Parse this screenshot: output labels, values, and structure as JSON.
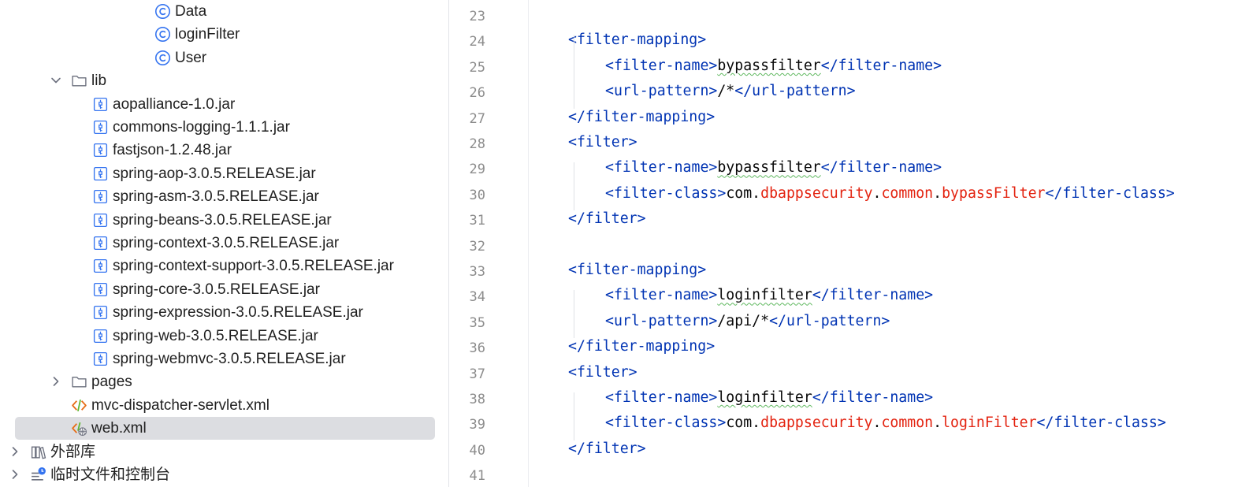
{
  "project_tree": {
    "items": [
      {
        "label": "Data",
        "icon": "java-class-icon",
        "indent": 3,
        "expanded": null
      },
      {
        "label": "loginFilter",
        "icon": "java-class-icon",
        "indent": 3,
        "expanded": null
      },
      {
        "label": "User",
        "icon": "java-class-icon",
        "indent": 3,
        "expanded": null
      },
      {
        "label": "lib",
        "icon": "folder-icon",
        "indent": 1,
        "expanded": true
      },
      {
        "label": "aopalliance-1.0.jar",
        "icon": "jar-icon",
        "indent": 2,
        "expanded": null
      },
      {
        "label": "commons-logging-1.1.1.jar",
        "icon": "jar-icon",
        "indent": 2,
        "expanded": null
      },
      {
        "label": "fastjson-1.2.48.jar",
        "icon": "jar-icon",
        "indent": 2,
        "expanded": null
      },
      {
        "label": "spring-aop-3.0.5.RELEASE.jar",
        "icon": "jar-icon",
        "indent": 2,
        "expanded": null
      },
      {
        "label": "spring-asm-3.0.5.RELEASE.jar",
        "icon": "jar-icon",
        "indent": 2,
        "expanded": null
      },
      {
        "label": "spring-beans-3.0.5.RELEASE.jar",
        "icon": "jar-icon",
        "indent": 2,
        "expanded": null
      },
      {
        "label": "spring-context-3.0.5.RELEASE.jar",
        "icon": "jar-icon",
        "indent": 2,
        "expanded": null
      },
      {
        "label": "spring-context-support-3.0.5.RELEASE.jar",
        "icon": "jar-icon",
        "indent": 2,
        "expanded": null
      },
      {
        "label": "spring-core-3.0.5.RELEASE.jar",
        "icon": "jar-icon",
        "indent": 2,
        "expanded": null
      },
      {
        "label": "spring-expression-3.0.5.RELEASE.jar",
        "icon": "jar-icon",
        "indent": 2,
        "expanded": null
      },
      {
        "label": "spring-web-3.0.5.RELEASE.jar",
        "icon": "jar-icon",
        "indent": 2,
        "expanded": null
      },
      {
        "label": "spring-webmvc-3.0.5.RELEASE.jar",
        "icon": "jar-icon",
        "indent": 2,
        "expanded": null
      },
      {
        "label": "pages",
        "icon": "folder-icon",
        "indent": 1,
        "expanded": false
      },
      {
        "label": "mvc-dispatcher-servlet.xml",
        "icon": "xml-file-icon",
        "indent": 1,
        "expanded": null
      },
      {
        "label": "web.xml",
        "icon": "web-xml-icon",
        "indent": 1,
        "expanded": null,
        "selected": true
      },
      {
        "label": "外部库",
        "icon": "library-icon",
        "indent": 0,
        "expanded": false
      },
      {
        "label": "临时文件和控制台",
        "icon": "scratch-icon",
        "indent": 0,
        "expanded": false
      }
    ]
  },
  "editor": {
    "lines": [
      {
        "num": "23",
        "indent": 0,
        "tokens": []
      },
      {
        "num": "24",
        "indent": 1,
        "tokens": [
          [
            "tag",
            "<filter-mapping>"
          ]
        ]
      },
      {
        "num": "25",
        "indent": 2,
        "tokens": [
          [
            "tag",
            "<filter-name>"
          ],
          [
            "sq",
            "bypassfilter"
          ],
          [
            "tag",
            "</filter-name>"
          ]
        ]
      },
      {
        "num": "26",
        "indent": 2,
        "tokens": [
          [
            "tag",
            "<url-pattern>"
          ],
          [
            "txt",
            "/*"
          ],
          [
            "tag",
            "</url-pattern>"
          ]
        ]
      },
      {
        "num": "27",
        "indent": 1,
        "tokens": [
          [
            "tag",
            "</filter-mapping>"
          ]
        ]
      },
      {
        "num": "28",
        "indent": 1,
        "tokens": [
          [
            "tag",
            "<filter>"
          ]
        ]
      },
      {
        "num": "29",
        "indent": 2,
        "tokens": [
          [
            "tag",
            "<filter-name>"
          ],
          [
            "sq",
            "bypassfilter"
          ],
          [
            "tag",
            "</filter-name>"
          ]
        ]
      },
      {
        "num": "30",
        "indent": 2,
        "tokens": [
          [
            "tag",
            "<filter-class>"
          ],
          [
            "txt",
            "com."
          ],
          [
            "pk",
            "dbappsecurity"
          ],
          [
            "txt",
            "."
          ],
          [
            "pk",
            "common"
          ],
          [
            "txt",
            "."
          ],
          [
            "pk",
            "bypassFilter"
          ],
          [
            "tag",
            "</filter-class>"
          ]
        ]
      },
      {
        "num": "31",
        "indent": 1,
        "tokens": [
          [
            "tag",
            "</filter>"
          ]
        ]
      },
      {
        "num": "32",
        "indent": 0,
        "tokens": []
      },
      {
        "num": "33",
        "indent": 1,
        "tokens": [
          [
            "tag",
            "<filter-mapping>"
          ]
        ]
      },
      {
        "num": "34",
        "indent": 2,
        "tokens": [
          [
            "tag",
            "<filter-name>"
          ],
          [
            "sq",
            "loginfilter"
          ],
          [
            "tag",
            "</filter-name>"
          ]
        ]
      },
      {
        "num": "35",
        "indent": 2,
        "tokens": [
          [
            "tag",
            "<url-pattern>"
          ],
          [
            "txt",
            "/api/*"
          ],
          [
            "tag",
            "</url-pattern>"
          ]
        ]
      },
      {
        "num": "36",
        "indent": 1,
        "tokens": [
          [
            "tag",
            "</filter-mapping>"
          ]
        ]
      },
      {
        "num": "37",
        "indent": 1,
        "tokens": [
          [
            "tag",
            "<filter>"
          ]
        ]
      },
      {
        "num": "38",
        "indent": 2,
        "tokens": [
          [
            "tag",
            "<filter-name>"
          ],
          [
            "sq",
            "loginfilter"
          ],
          [
            "tag",
            "</filter-name>"
          ]
        ]
      },
      {
        "num": "39",
        "indent": 2,
        "tokens": [
          [
            "tag",
            "<filter-class>"
          ],
          [
            "txt",
            "com."
          ],
          [
            "pk",
            "dbappsecurity"
          ],
          [
            "txt",
            "."
          ],
          [
            "pk",
            "common"
          ],
          [
            "txt",
            "."
          ],
          [
            "pk",
            "loginFilter"
          ],
          [
            "tag",
            "</filter-class>"
          ]
        ]
      },
      {
        "num": "40",
        "indent": 1,
        "tokens": [
          [
            "tag",
            "</filter>"
          ]
        ]
      },
      {
        "num": "41",
        "indent": 0,
        "tokens": []
      }
    ]
  },
  "colors": {
    "tag": "#0033b3",
    "package": "#e3220f",
    "text": "#080808",
    "line_number": "#8c8c8c",
    "selection": "#dcdde1",
    "java_class_icon": "#3574f0"
  }
}
